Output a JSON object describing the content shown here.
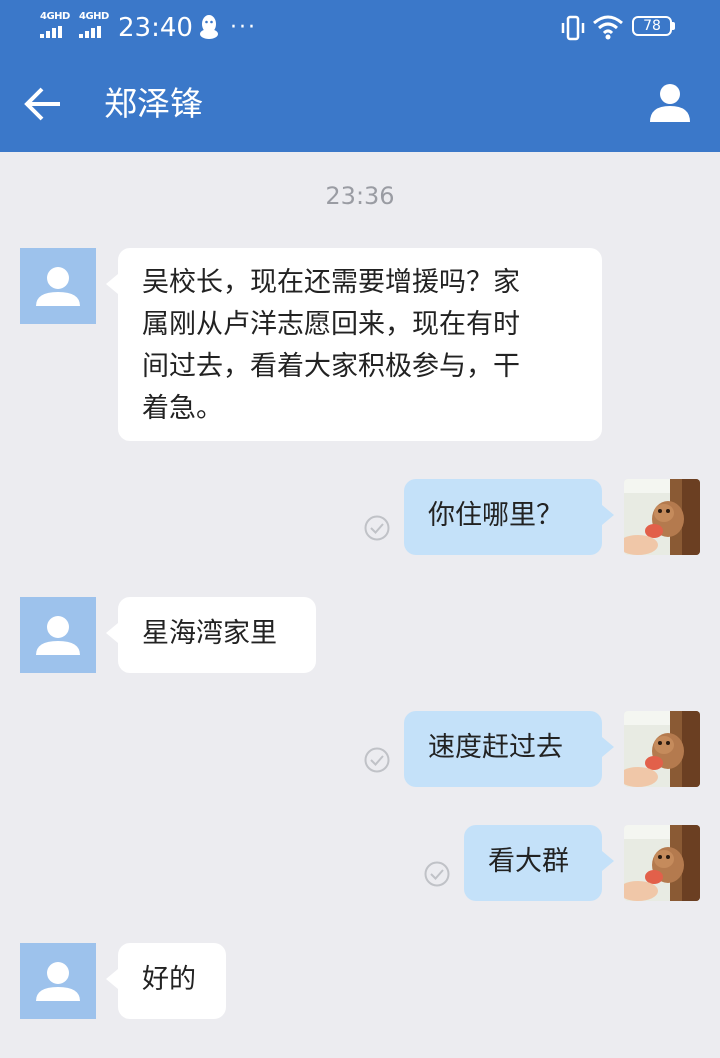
{
  "status_bar": {
    "sim1_label": "4GHD",
    "sim2_label": "4GHD",
    "time": "23:40",
    "more": "···",
    "battery_level": "78",
    "icons": [
      "signal-icon",
      "qq-icon",
      "more-icon",
      "vibrate-icon",
      "wifi-icon",
      "battery-icon"
    ]
  },
  "header": {
    "title": "郑泽锋",
    "back_icon": "back-arrow-icon",
    "profile_icon": "person-icon"
  },
  "colors": {
    "header_bg": "#3b78c9",
    "chat_bg": "#ececf0",
    "incoming_bubble": "#ffffff",
    "outgoing_bubble": "#c4e1f9",
    "contact_avatar": "#9dc2ec"
  },
  "chat": {
    "timestamp": "23:36",
    "messages": [
      {
        "side": "incoming",
        "lines": [
          "吴校长，现在还需要增援吗？家",
          "属刚从卢洋志愿回来，现在有时",
          "间过去，看着大家积极参与，干",
          "着急。"
        ]
      },
      {
        "side": "outgoing",
        "text": "你住哪里？",
        "status": "read-check-icon"
      },
      {
        "side": "incoming",
        "text": "星海湾家里"
      },
      {
        "side": "outgoing",
        "text": "速度赶过去",
        "status": "read-check-icon"
      },
      {
        "side": "outgoing",
        "text": "看大群",
        "status": "read-check-icon"
      },
      {
        "side": "incoming",
        "text": "好的"
      }
    ]
  }
}
